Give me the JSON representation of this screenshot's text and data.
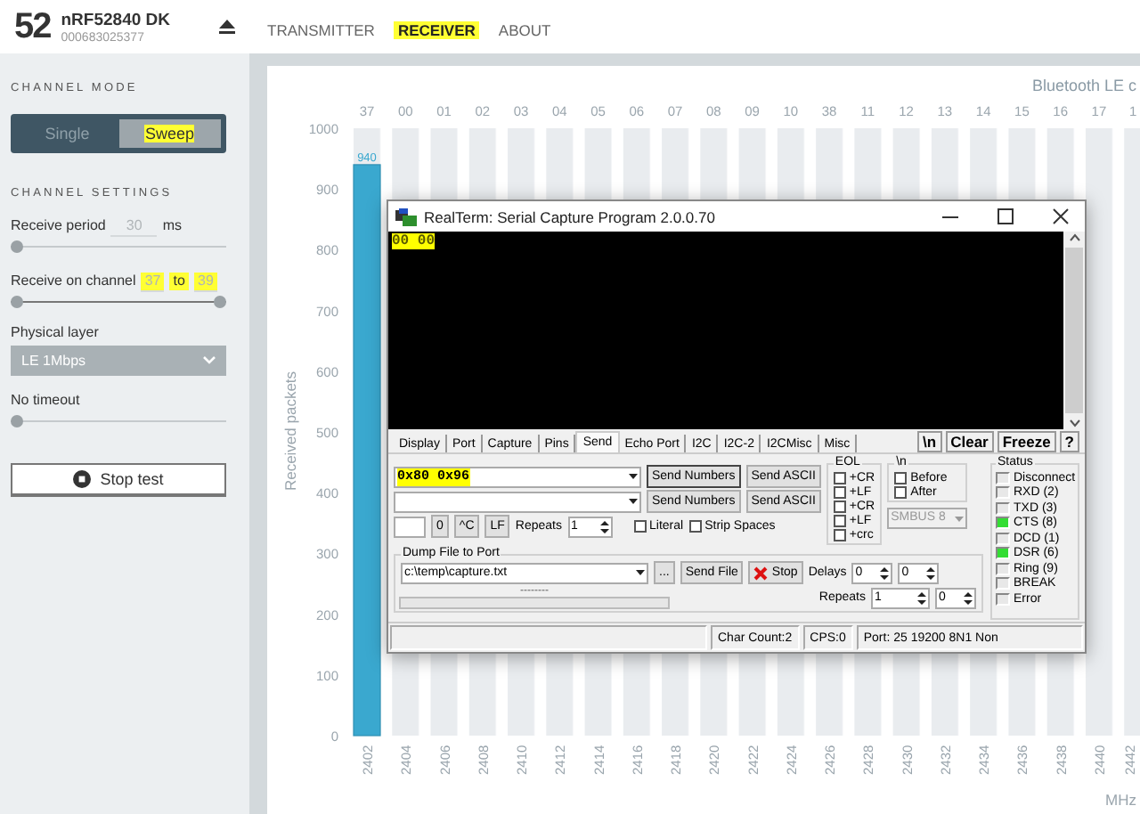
{
  "device": {
    "logo": "52",
    "name": "nRF52840 DK",
    "serial": "000683025377"
  },
  "nav": [
    {
      "label": "TRANSMITTER",
      "selected": false,
      "highlighted": false
    },
    {
      "label": "RECEIVER",
      "selected": true,
      "highlighted": true
    },
    {
      "label": "ABOUT",
      "selected": false,
      "highlighted": false
    }
  ],
  "sidebar": {
    "channel_mode": {
      "heading": "CHANNEL MODE",
      "options": [
        {
          "label": "Single",
          "selected": false,
          "highlighted": false
        },
        {
          "label": "Sweep",
          "selected": true,
          "highlighted": true
        }
      ]
    },
    "channel_settings": {
      "heading": "CHANNEL SETTINGS",
      "settings": [
        {
          "kind": "field-slider",
          "label": "Receive period",
          "value": "30",
          "unit": "ms",
          "level": 0
        },
        {
          "kind": "range-slider",
          "label": "Receive on channel",
          "from": "37",
          "separator": "to",
          "to": "39",
          "highlighted": true,
          "level": 1
        },
        {
          "kind": "dropdown",
          "label": "Physical layer",
          "value": "LE 1Mbps"
        },
        {
          "kind": "slider",
          "label": "No timeout",
          "level": 0
        }
      ]
    },
    "stop_button": "Stop test"
  },
  "chart": {
    "channel_labels": [
      "37",
      "00",
      "01",
      "02",
      "03",
      "04",
      "05",
      "06",
      "07",
      "08",
      "09",
      "10",
      "38",
      "11",
      "12",
      "13",
      "14",
      "15",
      "16",
      "17",
      "1"
    ],
    "chart_data": {
      "type": "bar",
      "title": "Bluetooth LE c",
      "xlabel": "MHz",
      "ylabel": "Received packets",
      "categories": [
        "2402",
        "2404",
        "2406",
        "2408",
        "2410",
        "2412",
        "2414",
        "2416",
        "2418",
        "2420",
        "2422",
        "2424",
        "2426",
        "2428",
        "2430",
        "2432",
        "2434",
        "2436",
        "2438",
        "2440",
        "2442"
      ],
      "values": [
        940,
        0,
        0,
        0,
        0,
        0,
        0,
        0,
        0,
        0,
        0,
        0,
        0,
        0,
        0,
        0,
        0,
        0,
        0,
        0,
        0
      ],
      "ylim": [
        0,
        1000
      ],
      "yticks": [
        0,
        100,
        200,
        300,
        400,
        500,
        600,
        700,
        800,
        900,
        1000
      ],
      "value_labels": [
        "940",
        null,
        null,
        null,
        null,
        null,
        null,
        null,
        null,
        null,
        null,
        null,
        null,
        null,
        null,
        null,
        null,
        null,
        null,
        null,
        null
      ]
    }
  },
  "realterm": {
    "title": "RealTerm: Serial Capture Program 2.0.0.70",
    "terminal": {
      "text": "00 00",
      "highlighted": true
    },
    "tabs": [
      {
        "label": "Display",
        "selected": false
      },
      {
        "label": "Port",
        "selected": false
      },
      {
        "label": "Capture",
        "selected": false
      },
      {
        "label": "Pins",
        "selected": false
      },
      {
        "label": "Send",
        "selected": true
      },
      {
        "label": "Echo Port",
        "selected": false
      },
      {
        "label": "I2C",
        "selected": false
      },
      {
        "label": "I2C-2",
        "selected": false
      },
      {
        "label": "I2CMisc",
        "selected": false
      },
      {
        "label": "Misc",
        "selected": false
      }
    ],
    "tool_buttons": [
      "\\n",
      "Clear",
      "Freeze",
      "?"
    ],
    "send_rows": [
      {
        "value": "0x80 0x96",
        "highlighted": true,
        "buttons": [
          "Send Numbers",
          "Send ASCII"
        ]
      },
      {
        "buttons": [
          "Send Numbers",
          "Send ASCII"
        ]
      }
    ],
    "keys": {
      "buttons": [
        "0",
        "^C",
        "LF"
      ],
      "repeats_label": "Repeats",
      "repeats": "1",
      "checkboxes": [
        {
          "label": "Literal",
          "checked": false
        },
        {
          "label": "Strip Spaces",
          "checked": false
        }
      ]
    },
    "eol": {
      "title": "EOL",
      "options": [
        {
          "label": "+CR",
          "checked": false
        },
        {
          "label": "+LF",
          "checked": false
        },
        {
          "label": "+CR",
          "checked": false
        },
        {
          "label": "+LF",
          "checked": false
        },
        {
          "label": "+crc",
          "checked": false
        }
      ]
    },
    "newline": {
      "title": "\\n",
      "options": [
        {
          "label": "Before",
          "checked": false
        },
        {
          "label": "After",
          "checked": false
        }
      ]
    },
    "smbus": {
      "value": "SMBUS 8",
      "disabled": true
    },
    "dump": {
      "title": "Dump File to Port",
      "file": "c:\\temp\\capture.txt",
      "buttons": [
        "...",
        "Send File",
        "Stop"
      ],
      "delays_label": "Delays",
      "delays": [
        "0",
        "0"
      ],
      "progress": {
        "label": "--------",
        "level": 0
      },
      "repeats_label": "Repeats",
      "repeats": [
        "1",
        "0"
      ]
    },
    "status": {
      "title": "Status",
      "signals": [
        {
          "label": "Disconnect",
          "on": false
        },
        {
          "label": "RXD (2)",
          "on": false
        },
        {
          "label": "TXD (3)",
          "on": false
        },
        {
          "label": "CTS (8)",
          "on": true
        },
        {
          "label": "DCD (1)",
          "on": false
        },
        {
          "label": "DSR (6)",
          "on": true
        },
        {
          "label": "Ring (9)",
          "on": false
        },
        {
          "label": "BREAK",
          "on": false
        },
        {
          "label": "Error",
          "on": false
        }
      ]
    },
    "status_bar": [
      "Char Count:2",
      "CPS:0",
      "Port: 25 19200 8N1 Non"
    ]
  }
}
